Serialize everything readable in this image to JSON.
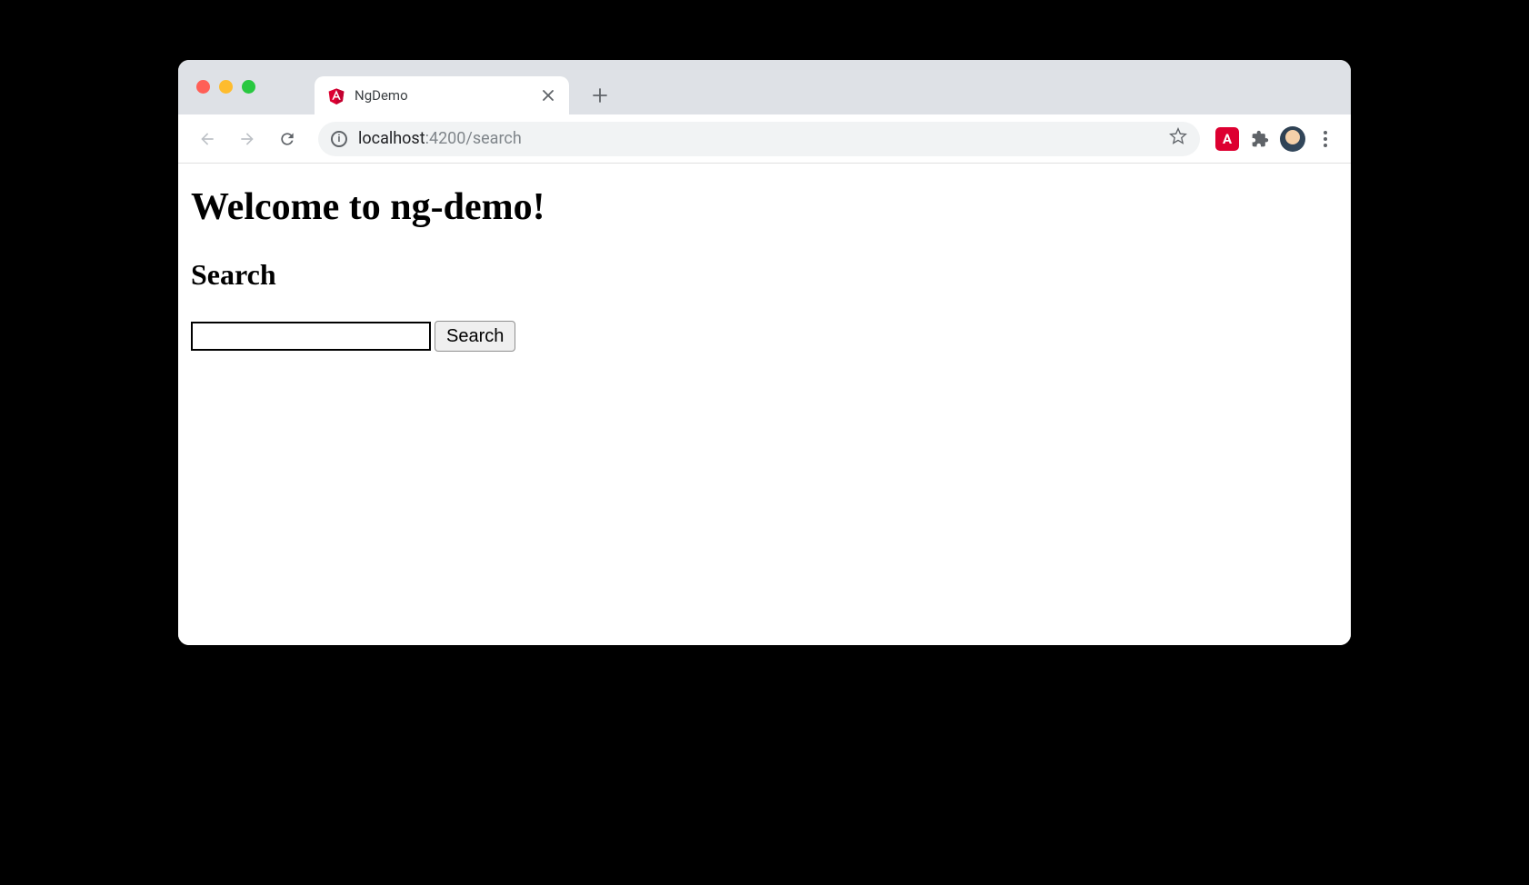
{
  "browser": {
    "tab": {
      "title": "NgDemo",
      "favicon": "angular-icon"
    },
    "url": {
      "host": "localhost",
      "path": ":4200/search"
    },
    "extensions": {
      "augury_label": "A"
    }
  },
  "page": {
    "heading": "Welcome to ng-demo!",
    "subheading": "Search",
    "search": {
      "input_value": "",
      "button_label": "Search"
    }
  }
}
